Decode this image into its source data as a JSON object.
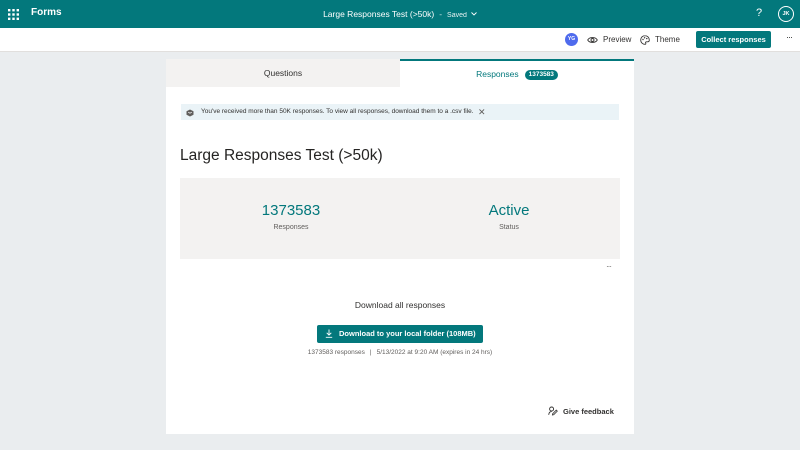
{
  "app": {
    "name": "Forms"
  },
  "document": {
    "title": "Large Responses Test (>50k)",
    "separator": "-",
    "save_status": "Saved"
  },
  "header": {
    "help": "?",
    "user_initials": "JK"
  },
  "commandbar": {
    "collaborator_initials": "YG",
    "preview_label": "Preview",
    "theme_label": "Theme",
    "collect_label": "Collect responses",
    "more": "···"
  },
  "tabs": [
    {
      "label": "Questions"
    },
    {
      "label": "Responses",
      "badge": "1373583"
    }
  ],
  "banner": {
    "message": "You've received more than 50K responses. To view all responses, download them to a .csv file.",
    "close": "✕"
  },
  "form": {
    "title": "Large Responses Test (>50k)"
  },
  "stats": {
    "responses_value": "1373583",
    "responses_label": "Responses",
    "status_value": "Active",
    "status_label": "Status",
    "more": "···"
  },
  "download": {
    "heading": "Download all responses",
    "button_label": "Download to your local folder (108MB)",
    "count": "1373583 responses",
    "separator": "|",
    "timestamp": "5/13/2022 at 9:20 AM",
    "expiry": "(expires in 24 hrs)"
  },
  "feedback": {
    "label": "Give feedback"
  },
  "colors": {
    "brand": "#03787c",
    "background": "#eaedef",
    "banner": "#eaf3f7",
    "stats_panel": "#f3f2f1"
  }
}
